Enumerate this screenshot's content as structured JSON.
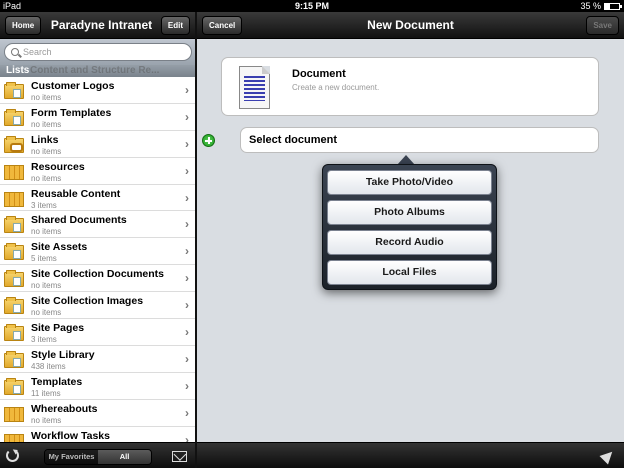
{
  "status_bar": {
    "device": "iPad",
    "time": "9:15 PM",
    "battery": "35 %",
    "battery_level": 0.35
  },
  "left_pane": {
    "nav": {
      "home_label": "Home",
      "title": "Paradyne Intranet",
      "edit_label": "Edit"
    },
    "search": {
      "placeholder": "Search"
    },
    "section_header": "Lists",
    "clipped_item": "Content and Structure Re...",
    "items": [
      {
        "name": "Customer Logos",
        "count": "no items",
        "icon": "document-folder-icon"
      },
      {
        "name": "Form Templates",
        "count": "no items",
        "icon": "document-folder-icon"
      },
      {
        "name": "Links",
        "count": "no items",
        "icon": "link-folder-icon"
      },
      {
        "name": "Resources",
        "count": "no items",
        "icon": "list-folder-icon"
      },
      {
        "name": "Reusable Content",
        "count": "3 items",
        "icon": "list-folder-icon"
      },
      {
        "name": "Shared Documents",
        "count": "no items",
        "icon": "document-folder-icon"
      },
      {
        "name": "Site Assets",
        "count": "5 items",
        "icon": "document-folder-icon"
      },
      {
        "name": "Site Collection Documents",
        "count": "no items",
        "icon": "document-folder-icon"
      },
      {
        "name": "Site Collection Images",
        "count": "no items",
        "icon": "document-folder-icon"
      },
      {
        "name": "Site Pages",
        "count": "3 items",
        "icon": "document-folder-icon"
      },
      {
        "name": "Style Library",
        "count": "438 items",
        "icon": "document-folder-icon"
      },
      {
        "name": "Templates",
        "count": "11 items",
        "icon": "document-folder-icon"
      },
      {
        "name": "Whereabouts",
        "count": "no items",
        "icon": "list-folder-icon"
      },
      {
        "name": "Workflow Tasks",
        "count": "",
        "icon": "list-folder-icon"
      }
    ],
    "bottom": {
      "seg_favorites": "My Favorites",
      "seg_all": "All"
    }
  },
  "right_pane": {
    "nav": {
      "cancel_label": "Cancel",
      "title": "New Document",
      "save_label": "Save"
    },
    "card": {
      "title": "Document",
      "subtitle": "Create a new document."
    },
    "select_label": "Select document",
    "popover": {
      "options": [
        "Take Photo/Video",
        "Photo Albums",
        "Record Audio",
        "Local Files"
      ]
    }
  }
}
